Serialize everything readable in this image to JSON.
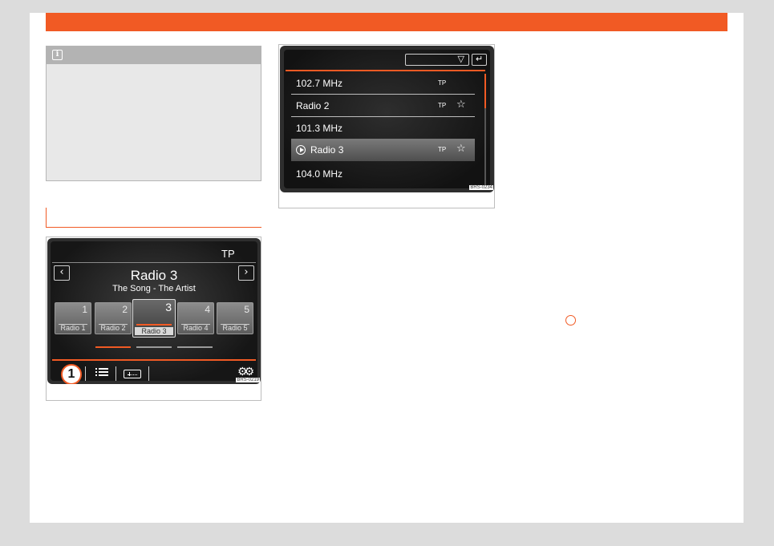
{
  "figure1": {
    "tp_label": "TP",
    "prev_icon": "chevron-left-icon",
    "next_icon": "chevron-right-icon",
    "station_name": "Radio 3",
    "now_playing": "The Song - The Artist",
    "presets": [
      {
        "number": "1",
        "label": "Radio 1"
      },
      {
        "number": "2",
        "label": "Radio 2"
      },
      {
        "number": "3",
        "label": "Radio 3",
        "active": true
      },
      {
        "number": "4",
        "label": "Radio 4"
      },
      {
        "number": "5",
        "label": "Radio 5"
      }
    ],
    "callout_number": "1",
    "image_code": "BRS-0219"
  },
  "figure2": {
    "dropdown_value": "",
    "stations": [
      {
        "name": "102.7 MHz",
        "tp": "TP",
        "favorite": false,
        "selected": false
      },
      {
        "name": "Radio 2",
        "tp": "TP",
        "favorite": true,
        "selected": false
      },
      {
        "name": "101.3 MHz",
        "tp": "",
        "favorite": false,
        "selected": false
      },
      {
        "name": "Radio 3",
        "tp": "TP",
        "favorite": true,
        "selected": true
      },
      {
        "name": "104.0 MHz",
        "tp": "",
        "favorite": false,
        "selected": false
      }
    ],
    "image_code": "BRS-0234"
  },
  "colors": {
    "accent": "#f15a24",
    "note_background": "#e8e8e8",
    "note_header": "#b3b3b3"
  }
}
